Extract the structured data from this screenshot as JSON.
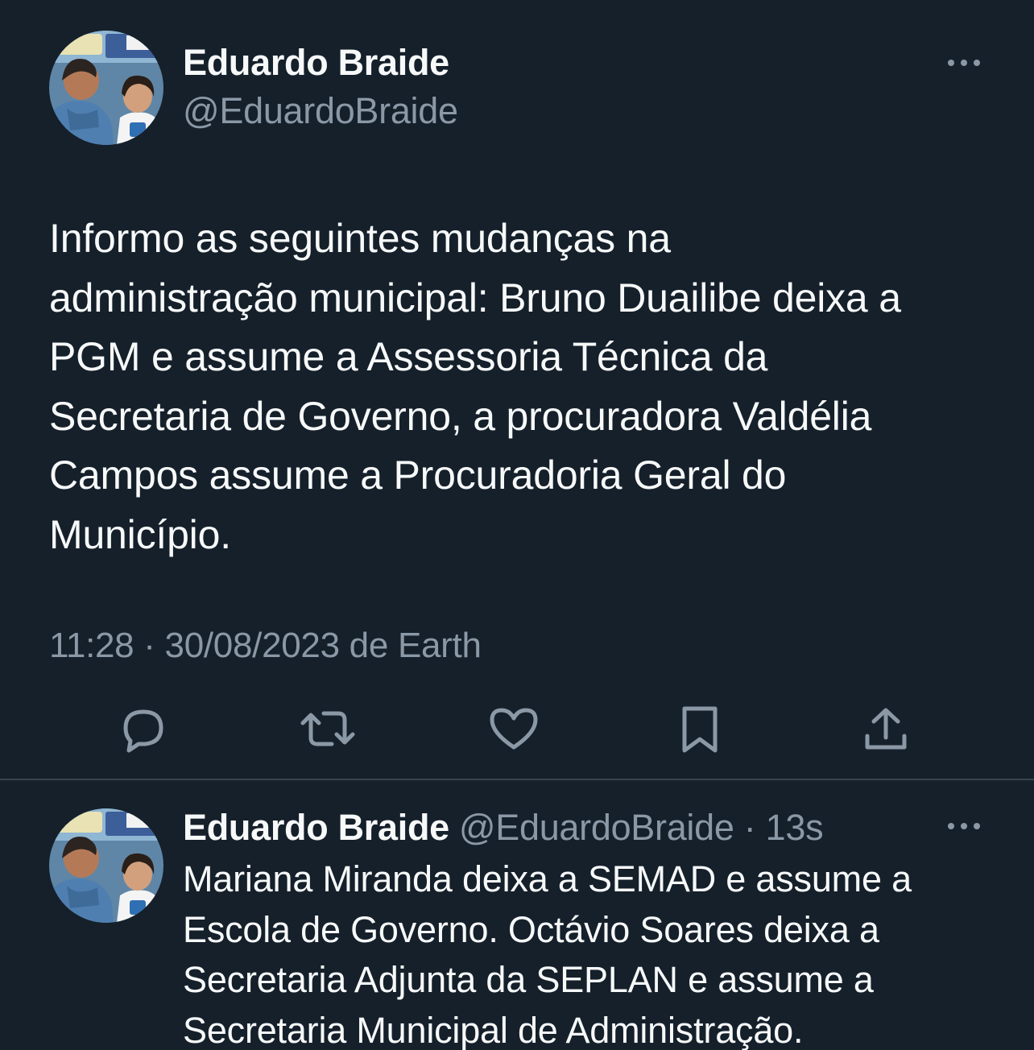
{
  "main_tweet": {
    "display_name": "Eduardo Braide",
    "handle": "@EduardoBraide",
    "text": "Informo as seguintes mudanças na\nadministração municipal: Bruno Duailibe deixa a\nPGM e assume a Assessoria Técnica da\nSecretaria de Governo, a procuradora Valdélia\nCampos assume a Procuradoria Geral do\nMunicípio.",
    "timestamp": "11:28 · 30/08/2023 de Earth"
  },
  "actions": {
    "reply_icon": "reply-icon",
    "retweet_icon": "retweet-icon",
    "like_icon": "heart-icon",
    "bookmark_icon": "bookmark-icon",
    "share_icon": "share-icon"
  },
  "reply_tweet": {
    "display_name": "Eduardo Braide",
    "handle": "@EduardoBraide",
    "time": "13s",
    "text": "Mariana Miranda deixa a SEMAD e assume a\nEscola de Governo. Octávio Soares deixa a\nSecretaria Adjunta da SEPLAN e assume a\nSecretaria Municipal de Administração."
  },
  "colors": {
    "background": "#15202b",
    "primary_text": "#f7f9f9",
    "secondary_text": "#8b98a5",
    "divider": "#38444d"
  }
}
